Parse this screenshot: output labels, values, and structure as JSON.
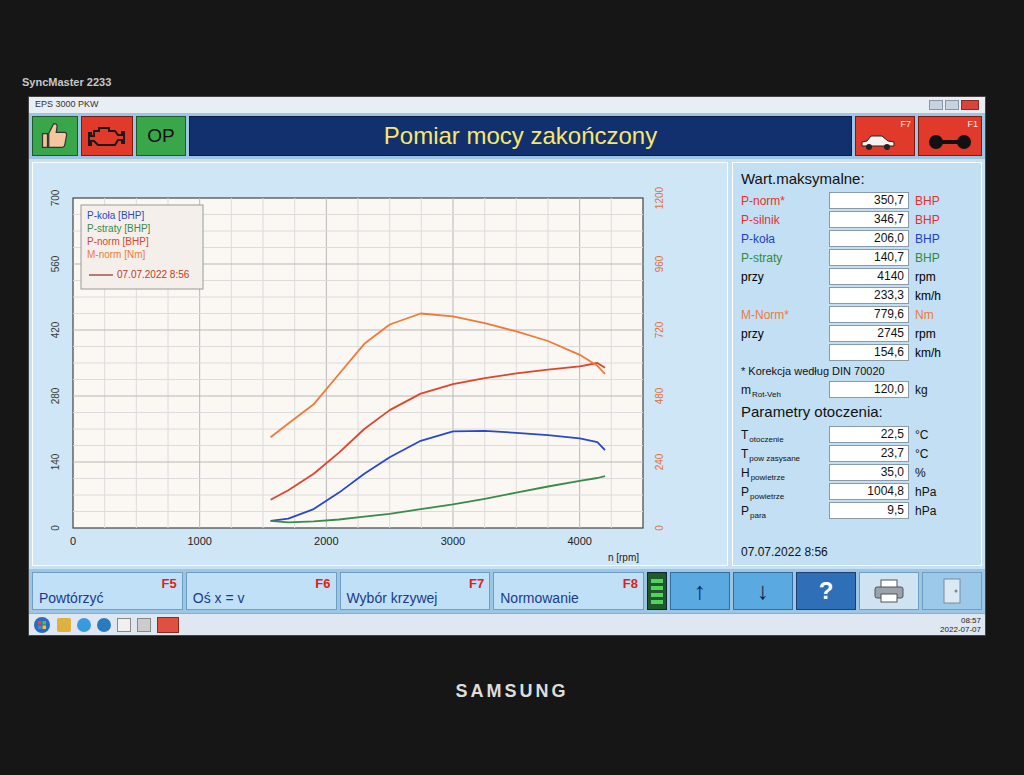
{
  "monitor": {
    "model": "SyncMaster 2233",
    "brand": "SAMSUNG"
  },
  "window": {
    "title": "EPS 3000 PKW"
  },
  "toolbar": {
    "status_label": "OP",
    "title": "Pomiar mocy zakończony",
    "keys": [
      "F7",
      "F1"
    ]
  },
  "chart": {
    "y_left_ticks": [
      "0",
      "140",
      "280",
      "420",
      "560",
      "700"
    ],
    "y_right_ticks": [
      "0",
      "240",
      "480",
      "720",
      "960",
      "1200"
    ],
    "x_ticks": [
      "0",
      "1000",
      "2000",
      "3000",
      "4000"
    ],
    "x_label": "n [rpm]",
    "legend_date": "07.07.2022 8:56",
    "rpm": [
      1560,
      1700,
      1900,
      2100,
      2300,
      2500,
      2745,
      3000,
      3250,
      3500,
      3750,
      4000,
      4140,
      4200
    ],
    "series": [
      {
        "label": "P-koła [BHP]",
        "kind": "power",
        "color": "#2a48c8",
        "values": [
          15,
          20,
          40,
          75,
          115,
          150,
          185,
          205,
          206,
          202,
          197,
          190,
          182,
          165
        ]
      },
      {
        "label": "P-straty [BHP]",
        "kind": "power",
        "color": "#3a8a4a",
        "values": [
          15,
          12,
          14,
          18,
          24,
          30,
          40,
          50,
          62,
          75,
          88,
          100,
          106,
          110
        ]
      },
      {
        "label": "P-norm [BHP]",
        "kind": "power",
        "color": "#e0442c",
        "values": [
          60,
          80,
          115,
          160,
          210,
          250,
          285,
          305,
          318,
          328,
          336,
          343,
          350,
          340
        ]
      },
      {
        "label": "M-norm [Nm]",
        "kind": "torque",
        "color": "#f07a3a",
        "values": [
          330,
          380,
          450,
          560,
          670,
          740,
          780,
          770,
          745,
          715,
          680,
          630,
          590,
          560
        ]
      }
    ]
  },
  "max": {
    "title": "Wart.maksymalne:",
    "rows": [
      {
        "label": "P-norm*",
        "sub": "",
        "value": "350,7",
        "unit": "BHP",
        "color": "#e8302a"
      },
      {
        "label": "P-silnik",
        "sub": "",
        "value": "346,7",
        "unit": "BHP",
        "color": "#e8302a"
      },
      {
        "label": "P-koła",
        "sub": "",
        "value": "206,0",
        "unit": "BHP",
        "color": "#1d3fd0"
      },
      {
        "label": "P-straty",
        "sub": "",
        "value": "140,7",
        "unit": "BHP",
        "color": "#2e8b3c"
      },
      {
        "label": "przy",
        "sub": "",
        "value": "4140",
        "unit": "rpm",
        "color": "#000000"
      },
      {
        "label": "",
        "sub": "",
        "value": "233,3",
        "unit": "km/h",
        "color": "#000000"
      },
      {
        "label": "M-Norm*",
        "sub": "",
        "value": "779,6",
        "unit": "Nm",
        "color": "#f07a3a"
      },
      {
        "label": "przy",
        "sub": "",
        "value": "2745",
        "unit": "rpm",
        "color": "#000000"
      },
      {
        "label": "",
        "sub": "",
        "value": "154,6",
        "unit": "km/h",
        "color": "#000000"
      }
    ],
    "note": "* Korekcja według DIN 70020",
    "mass": {
      "label": "m",
      "sub": "Rot-Veh",
      "value": "120,0",
      "unit": "kg"
    }
  },
  "ambient": {
    "title": "Parametry otoczenia:",
    "rows": [
      {
        "label": "T",
        "sub": "otoczenie",
        "value": "22,5",
        "unit": "°C"
      },
      {
        "label": "T",
        "sub": "pow zasysane",
        "value": "23,7",
        "unit": "°C"
      },
      {
        "label": "H",
        "sub": "powietrze",
        "value": "35,0",
        "unit": "%"
      },
      {
        "label": "P",
        "sub": "powietrze",
        "value": "1004,8",
        "unit": "hPa"
      },
      {
        "label": "P",
        "sub": "para",
        "value": "9,5",
        "unit": "hPa"
      }
    ]
  },
  "date": "07.07.2022 8:56",
  "buttons": [
    {
      "label": "Powtórzyć",
      "key": "F5"
    },
    {
      "label": "Oś x = v",
      "key": "F6"
    },
    {
      "label": "Wybór krzywej",
      "key": "F7"
    },
    {
      "label": "Normowanie",
      "key": "F8"
    }
  ],
  "nav": [
    "↑",
    "↓",
    "?"
  ],
  "taskbar": {
    "time": "08:57",
    "date": "2022-07-07"
  }
}
